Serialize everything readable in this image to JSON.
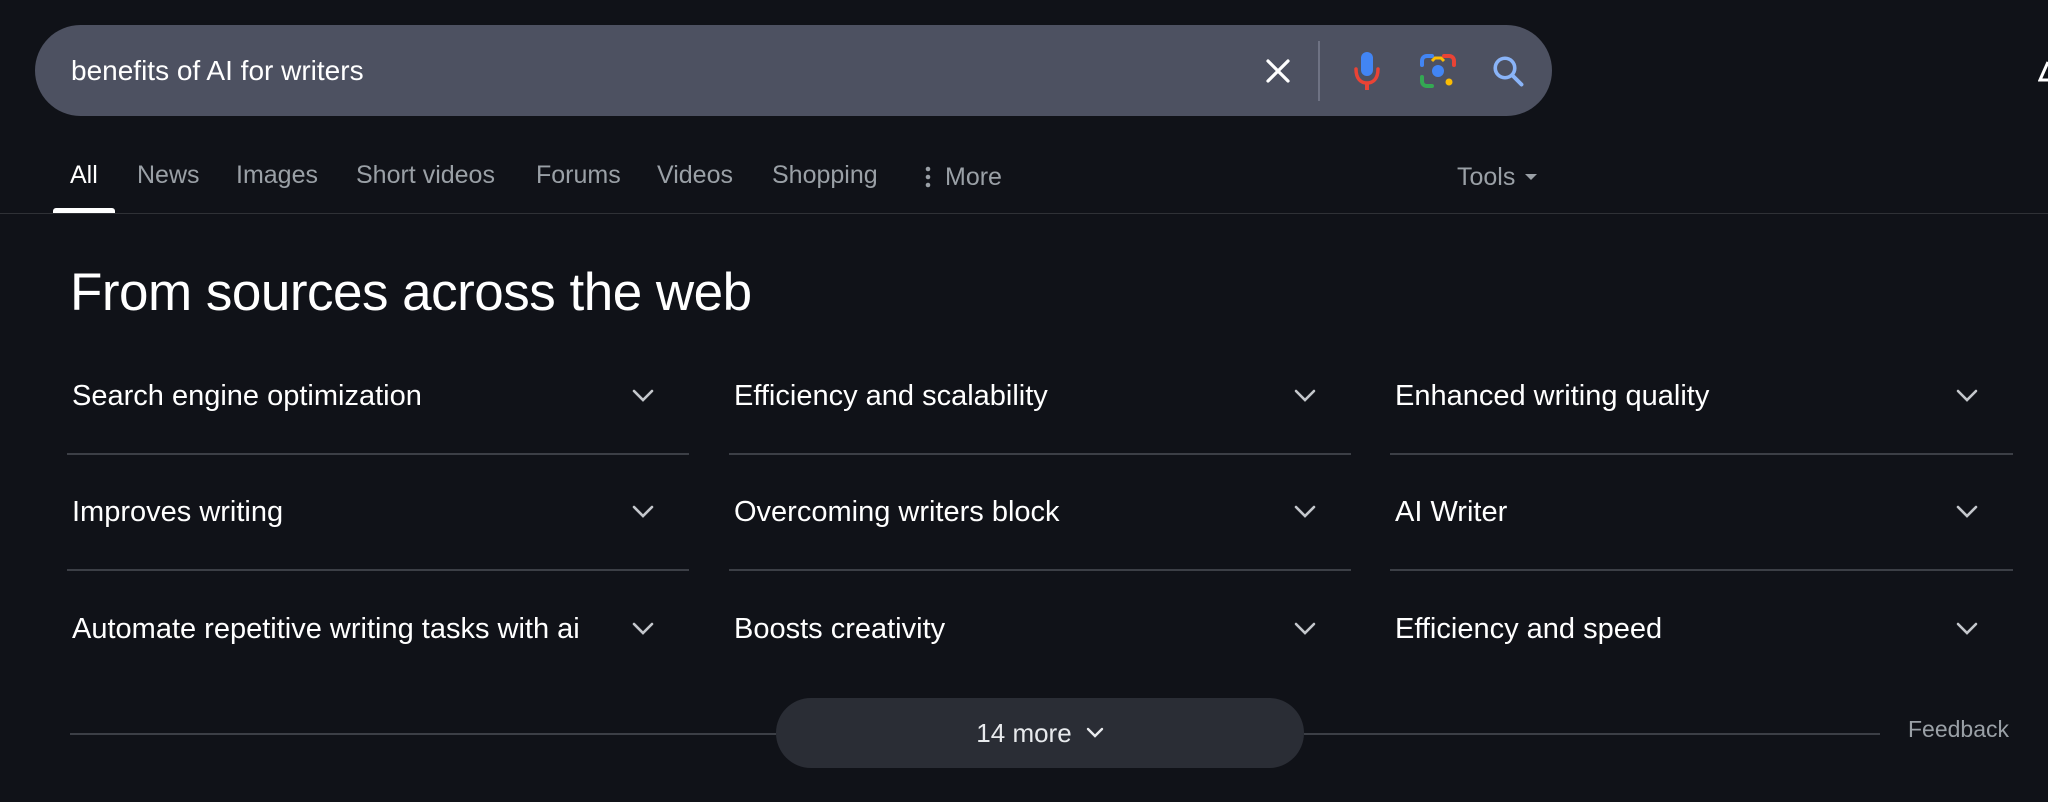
{
  "search": {
    "query": "benefits of AI for writers"
  },
  "tabs": [
    {
      "label": "All",
      "active": true
    },
    {
      "label": "News"
    },
    {
      "label": "Images"
    },
    {
      "label": "Short videos"
    },
    {
      "label": "Forums"
    },
    {
      "label": "Videos"
    },
    {
      "label": "Shopping"
    },
    {
      "label": "More"
    }
  ],
  "tools_label": "Tools",
  "section": {
    "heading": "From sources across the web",
    "items": [
      "Search engine optimization",
      "Efficiency and scalability",
      "Enhanced writing quality",
      "Improves writing",
      "Overcoming writers block",
      "AI Writer",
      "Automate repetitive writing tasks with ai",
      "Boosts creativity",
      "Efficiency and speed"
    ],
    "more_label": "14 more",
    "feedback_label": "Feedback"
  },
  "icons": {
    "clear": "close-icon",
    "voice": "microphone-icon",
    "lens": "camera-lens-icon",
    "search": "search-icon",
    "item_toggle": "chevron-down-icon"
  },
  "colors": {
    "background": "#101218",
    "searchbar": "#4d5161",
    "mic_blue": "#4285f4",
    "mic_red": "#ea4335",
    "lens_yellow": "#fbbc04",
    "lens_green": "#34a853"
  }
}
